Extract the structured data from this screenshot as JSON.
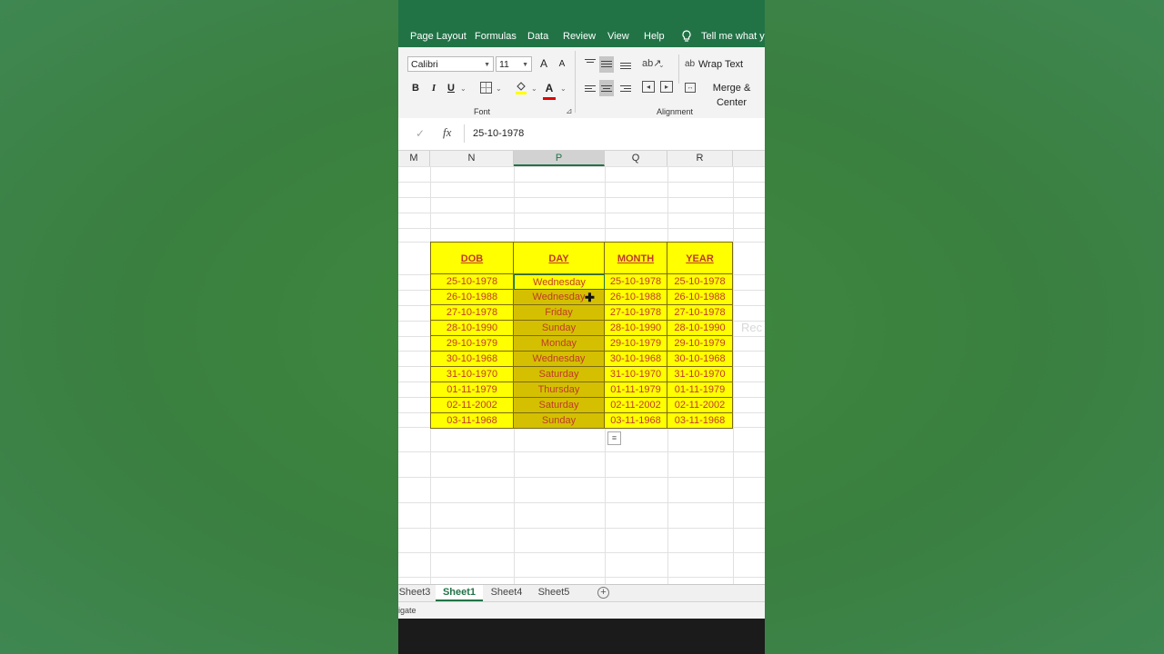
{
  "menu": {
    "tabs": [
      "Page Layout",
      "Formulas",
      "Data",
      "Review",
      "View",
      "Help"
    ],
    "tell_me": "Tell me what yo"
  },
  "ribbon": {
    "font": {
      "name": "Calibri",
      "size": "11",
      "group_label": "Font",
      "bold": "B",
      "italic": "I",
      "underline": "U",
      "grow": "A",
      "shrink": "A",
      "font_color_letter": "A"
    },
    "alignment": {
      "wrap_text": "Wrap Text",
      "merge_center": "Merge & Center",
      "group_label": "Alignment"
    }
  },
  "formula_bar": {
    "fx": "fx",
    "value": "25-10-1978"
  },
  "columns": [
    "M",
    "N",
    "P",
    "Q",
    "R"
  ],
  "selected_column": "P",
  "table": {
    "headers": [
      "DOB",
      "DAY",
      "MONTH",
      "YEAR"
    ],
    "rows": [
      [
        "25-10-1978",
        "Wednesday",
        "25-10-1978",
        "25-10-1978"
      ],
      [
        "26-10-1988",
        "Wednesday",
        "26-10-1988",
        "26-10-1988"
      ],
      [
        "27-10-1978",
        "Friday",
        "27-10-1978",
        "27-10-1978"
      ],
      [
        "28-10-1990",
        "Sunday",
        "28-10-1990",
        "28-10-1990"
      ],
      [
        "29-10-1979",
        "Monday",
        "29-10-1979",
        "29-10-1979"
      ],
      [
        "30-10-1968",
        "Wednesday",
        "30-10-1968",
        "30-10-1968"
      ],
      [
        "31-10-1970",
        "Saturday",
        "31-10-1970",
        "31-10-1970"
      ],
      [
        "01-11-1979",
        "Thursday",
        "01-11-1979",
        "01-11-1979"
      ],
      [
        "02-11-2002",
        "Saturday",
        "02-11-2002",
        "02-11-2002"
      ],
      [
        "03-11-1968",
        "Sunday",
        "03-11-1968",
        "03-11-1968"
      ]
    ]
  },
  "side_hint": "Rec",
  "sheets": [
    "Sheet3",
    "Sheet1",
    "Sheet4",
    "Sheet5"
  ],
  "active_sheet": "Sheet1",
  "status": "igate",
  "colors": {
    "excel_green": "#217346",
    "cell_fill": "#ffff00",
    "selected_fill": "#d4c000",
    "cell_text": "#c0392b"
  }
}
